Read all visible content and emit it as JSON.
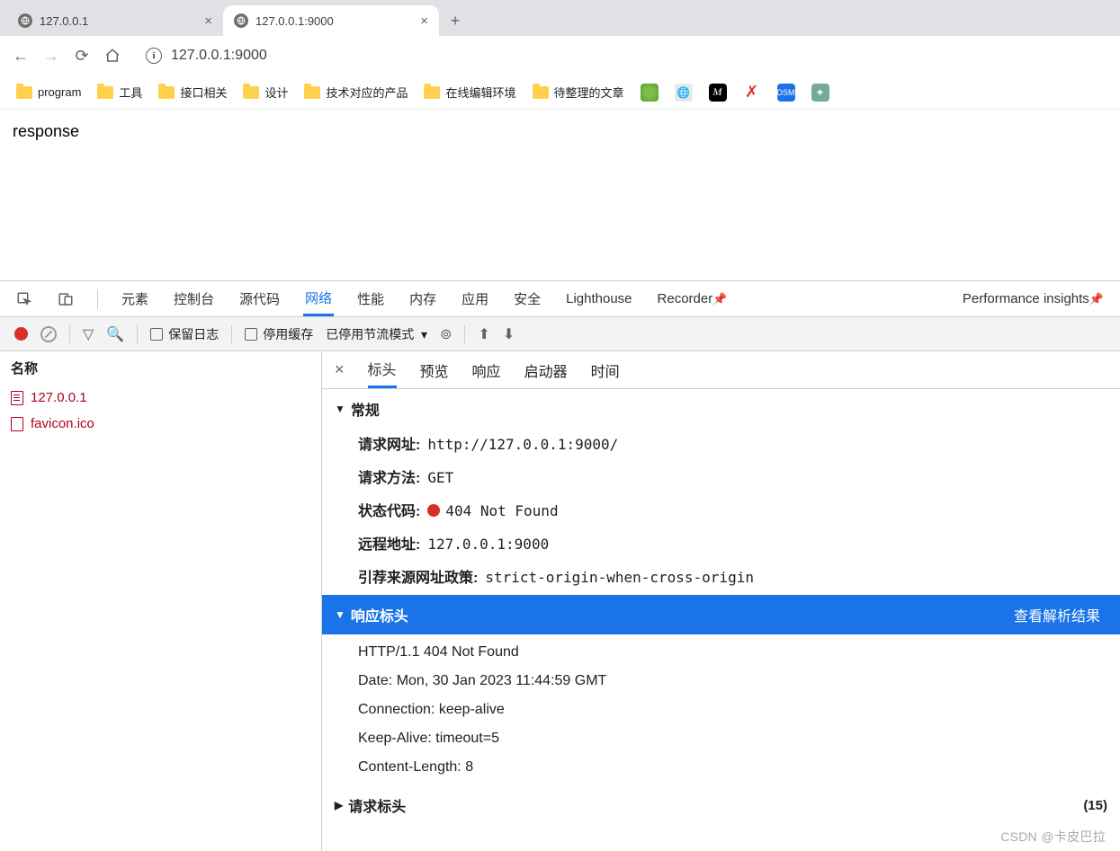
{
  "tabs": [
    {
      "title": "127.0.0.1",
      "active": false
    },
    {
      "title": "127.0.0.1:9000",
      "active": true
    }
  ],
  "address": "127.0.0.1:9000",
  "bookmarks": {
    "folders": [
      "program",
      "工具",
      "接口相关",
      "设计",
      "技术对应的产品",
      "在线编辑环境",
      "待整理的文章"
    ]
  },
  "pageBody": "response",
  "devtools": {
    "panels": [
      "元素",
      "控制台",
      "源代码",
      "网络",
      "性能",
      "内存",
      "应用",
      "安全",
      "Lighthouse"
    ],
    "activePanel": "网络",
    "extraPanels": [
      "Recorder",
      "Performance insights"
    ],
    "netToolbar": {
      "preserveLog": "保留日志",
      "disableCache": "停用缓存",
      "throttle": "已停用节流模式"
    },
    "requestList": {
      "header": "名称",
      "items": [
        "127.0.0.1",
        "favicon.ico"
      ]
    },
    "detail": {
      "tabs": [
        "标头",
        "预览",
        "响应",
        "启动器",
        "时间"
      ],
      "activeTab": "标头",
      "general": {
        "title": "常规",
        "rows": {
          "url_k": "请求网址:",
          "url_v": "http://127.0.0.1:9000/",
          "method_k": "请求方法:",
          "method_v": "GET",
          "status_k": "状态代码:",
          "status_v": "404 Not Found",
          "remote_k": "远程地址:",
          "remote_v": "127.0.0.1:9000",
          "referrer_k": "引荐来源网址政策:",
          "referrer_v": "strict-origin-when-cross-origin"
        }
      },
      "responseHeaders": {
        "title": "响应标头",
        "linkLabel": "查看解析结果",
        "lines": [
          "HTTP/1.1 404 Not Found",
          "Date: Mon, 30 Jan 2023 11:44:59 GMT",
          "Connection: keep-alive",
          "Keep-Alive: timeout=5",
          "Content-Length: 8"
        ]
      },
      "requestHeaders": {
        "title": "请求标头",
        "count": "(15)"
      }
    }
  },
  "watermark": "CSDN @卡皮巴拉"
}
